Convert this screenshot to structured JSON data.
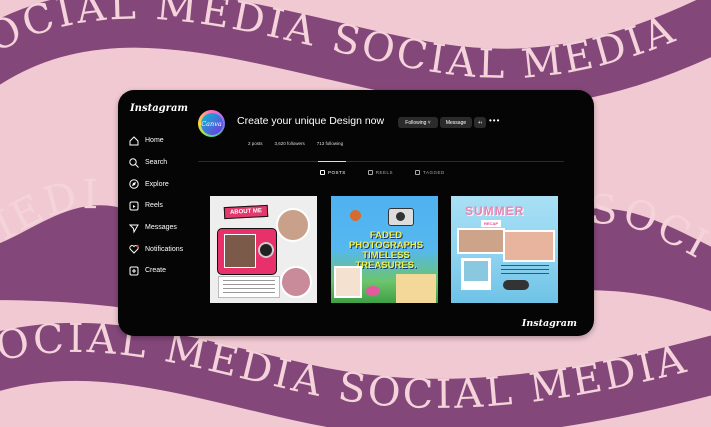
{
  "background": {
    "colors": {
      "base": "#f1c9d3",
      "band": "#84477a",
      "band_text": "#f4d3db"
    },
    "wave_top": "SOCIAL MEDIA SOCIAL MEDIA",
    "wave_middle_left": "MEDI",
    "wave_middle_right": "SOCI",
    "wave_bottom": "SOCIAL MEDIA SOCIAL MEDIA"
  },
  "app": {
    "name": "Instagram",
    "watermark": "Instagram"
  },
  "sidebar": {
    "items": [
      {
        "label": "Home",
        "icon": "home-icon"
      },
      {
        "label": "Search",
        "icon": "search-icon"
      },
      {
        "label": "Explore",
        "icon": "compass-icon"
      },
      {
        "label": "Reels",
        "icon": "reels-icon"
      },
      {
        "label": "Messages",
        "icon": "send-icon"
      },
      {
        "label": "Notifications",
        "icon": "heart-icon"
      },
      {
        "label": "Create",
        "icon": "plus-square-icon"
      }
    ]
  },
  "profile": {
    "avatar_text": "Canva",
    "name": "Create your unique Design now",
    "buttons": {
      "following": "Following ˅",
      "message": "Message",
      "add": "+‹",
      "more": "•••"
    },
    "stats": {
      "posts": "2 posts",
      "followers": "3,620 followers",
      "following": "713 following"
    }
  },
  "tabs": [
    {
      "label": "POSTS",
      "active": true
    },
    {
      "label": "REELS",
      "active": false
    },
    {
      "label": "TAGGED",
      "active": false
    }
  ],
  "posts": [
    {
      "title": "ABOUT ME",
      "subtitle": "Meet Jessica"
    },
    {
      "title": "FADED PHOTOGRAPHS TIMELESS TREASURES."
    },
    {
      "title": "SUMMER",
      "subtitle": "RECAP"
    }
  ]
}
